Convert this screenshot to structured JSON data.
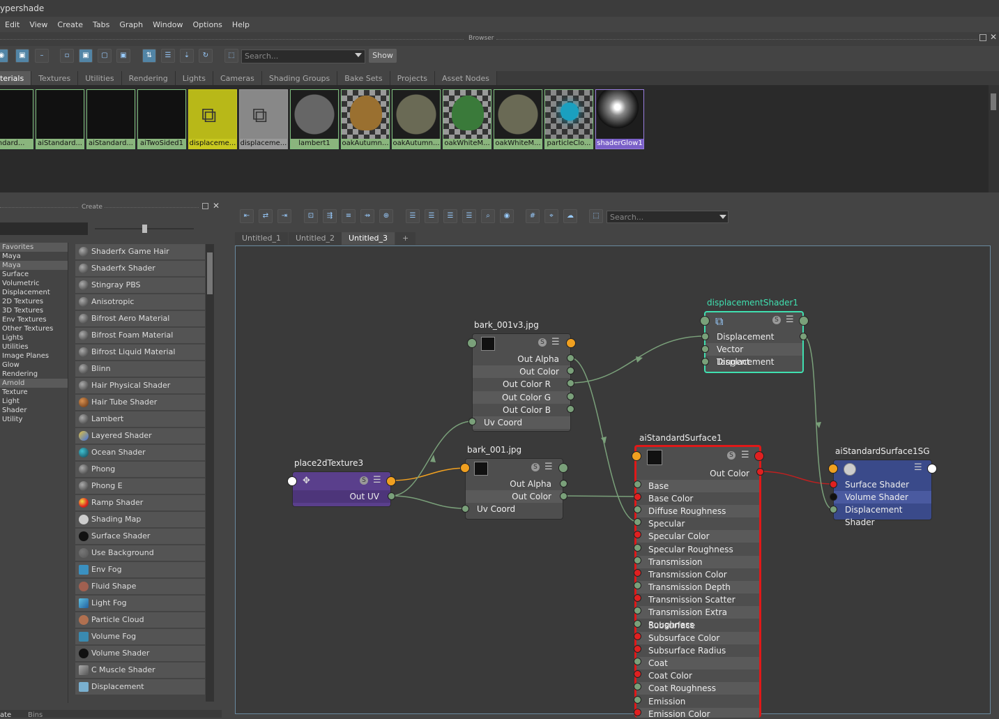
{
  "window": {
    "title": "ypershade"
  },
  "menu": [
    "Edit",
    "View",
    "Create",
    "Tabs",
    "Graph",
    "Window",
    "Options",
    "Help"
  ],
  "browser": {
    "label": "Browser",
    "search_placeholder": "Search...",
    "show_button": "Show",
    "tabs": [
      "terials",
      "Textures",
      "Utilities",
      "Rendering",
      "Lights",
      "Cameras",
      "Shading Groups",
      "Bake Sets",
      "Projects",
      "Asset Nodes"
    ],
    "swatches": [
      "andard...",
      "aiStandard...",
      "aiStandard...",
      "aiTwoSided1",
      "displaceme...",
      "displaceme...",
      "lambert1",
      "oakAutumn...",
      "oakAutumn...",
      "oakWhiteM...",
      "oakWhiteM...",
      "particleClo...",
      "shaderGlow1"
    ]
  },
  "create": {
    "label": "Create",
    "categories": [
      "Favorites",
      "Maya",
      "Maya",
      "Surface",
      "Volumetric",
      "Displacement",
      "2D Textures",
      "3D Textures",
      "Env Textures",
      "Other Textures",
      "Lights",
      "Utilities",
      "Image Planes",
      "Glow",
      "Rendering",
      "Arnold",
      "Texture",
      "Light",
      "Shader",
      "Utility"
    ],
    "items": [
      "Shaderfx Game Hair",
      "Shaderfx Shader",
      "Stingray PBS",
      "Anisotropic",
      "Bifrost Aero Material",
      "Bifrost Foam Material",
      "Bifrost Liquid Material",
      "Blinn",
      "Hair Physical Shader",
      "Hair Tube Shader",
      "Lambert",
      "Layered Shader",
      "Ocean Shader",
      "Phong",
      "Phong E",
      "Ramp Shader",
      "Shading Map",
      "Surface Shader",
      "Use Background",
      "Env Fog",
      "Fluid Shape",
      "Light Fog",
      "Particle Cloud",
      "Volume Fog",
      "Volume Shader",
      "C Muscle Shader",
      "Displacement"
    ],
    "bottom_tabs": [
      "ate",
      "Bins"
    ]
  },
  "graph": {
    "search_placeholder": "Search...",
    "tabs": [
      "Untitled_1",
      "Untitled_2",
      "Untitled_3",
      "+"
    ],
    "nodes": {
      "bark1": {
        "title": "bark_001v3.jpg",
        "rows": [
          "Out Alpha",
          "Out Color",
          "Out Color R",
          "Out Color G",
          "Out Color B",
          "Uv Coord"
        ]
      },
      "bark2": {
        "title": "bark_001.jpg",
        "rows": [
          "Out Alpha",
          "Out Color",
          "Uv Coord"
        ]
      },
      "place": {
        "title": "place2dTexture3",
        "rows": [
          "Out UV"
        ]
      },
      "disp": {
        "title": "displacementShader1",
        "rows": [
          "Displacement",
          "Vector Displacement",
          "Tangent"
        ]
      },
      "ai": {
        "title": "aiStandardSurface1",
        "out": "Out Color",
        "rows": [
          "Base",
          "Base Color",
          "Diffuse Roughness",
          "Specular",
          "Specular Color",
          "Specular Roughness",
          "Transmission",
          "Transmission Color",
          "Transmission Depth",
          "Transmission Scatter",
          "Transmission Extra Roughness",
          "Subsurface",
          "Subsurface Color",
          "Subsurface Radius",
          "Coat",
          "Coat Color",
          "Coat Roughness",
          "Emission",
          "Emission Color"
        ]
      },
      "sg": {
        "title": "aiStandardSurface1SG",
        "rows": [
          "Surface Shader",
          "Volume Shader",
          "Displacement Shader"
        ]
      }
    }
  }
}
